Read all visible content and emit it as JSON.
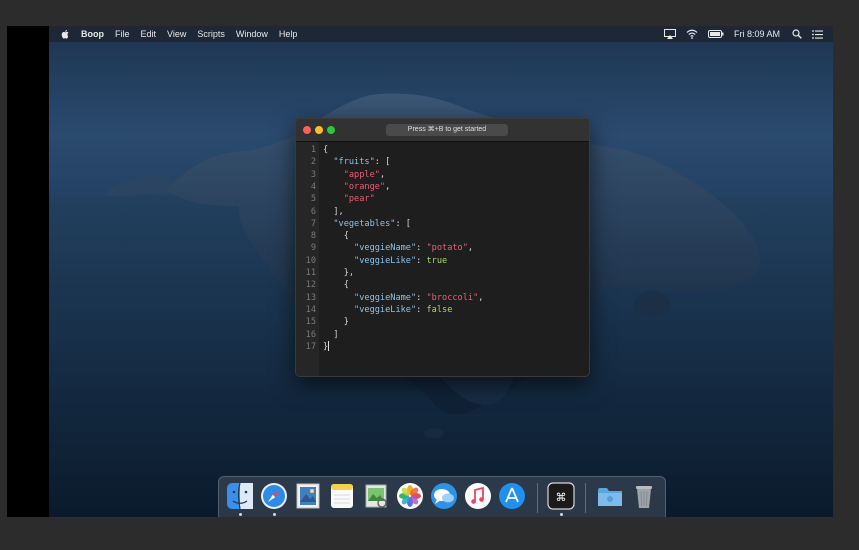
{
  "menubar": {
    "app_name": "Boop",
    "menus": [
      "File",
      "Edit",
      "View",
      "Scripts",
      "Window",
      "Help"
    ],
    "clock": "Fri 8:09 AM"
  },
  "window": {
    "search_placeholder": "Press ⌘+B to get started"
  },
  "editor": {
    "lines": [
      {
        "n": "1",
        "tokens": [
          {
            "t": "{",
            "c": "punc"
          }
        ]
      },
      {
        "n": "2",
        "tokens": [
          {
            "t": "  ",
            "c": "punc"
          },
          {
            "t": "\"fruits\"",
            "c": "key"
          },
          {
            "t": ": [",
            "c": "punc"
          }
        ]
      },
      {
        "n": "3",
        "tokens": [
          {
            "t": "    ",
            "c": "punc"
          },
          {
            "t": "\"apple\"",
            "c": "str"
          },
          {
            "t": ",",
            "c": "punc"
          }
        ]
      },
      {
        "n": "4",
        "tokens": [
          {
            "t": "    ",
            "c": "punc"
          },
          {
            "t": "\"orange\"",
            "c": "str"
          },
          {
            "t": ",",
            "c": "punc"
          }
        ]
      },
      {
        "n": "5",
        "tokens": [
          {
            "t": "    ",
            "c": "punc"
          },
          {
            "t": "\"pear\"",
            "c": "str"
          }
        ]
      },
      {
        "n": "6",
        "tokens": [
          {
            "t": "  ],",
            "c": "punc"
          }
        ]
      },
      {
        "n": "7",
        "tokens": [
          {
            "t": "  ",
            "c": "punc"
          },
          {
            "t": "\"vegetables\"",
            "c": "key"
          },
          {
            "t": ": [",
            "c": "punc"
          }
        ]
      },
      {
        "n": "8",
        "tokens": [
          {
            "t": "    {",
            "c": "punc"
          }
        ]
      },
      {
        "n": "9",
        "tokens": [
          {
            "t": "      ",
            "c": "punc"
          },
          {
            "t": "\"veggieName\"",
            "c": "key"
          },
          {
            "t": ": ",
            "c": "punc"
          },
          {
            "t": "\"potato\"",
            "c": "str"
          },
          {
            "t": ",",
            "c": "punc"
          }
        ]
      },
      {
        "n": "10",
        "tokens": [
          {
            "t": "      ",
            "c": "punc"
          },
          {
            "t": "\"veggieLike\"",
            "c": "key"
          },
          {
            "t": ": ",
            "c": "punc"
          },
          {
            "t": "true",
            "c": "bool"
          }
        ]
      },
      {
        "n": "11",
        "tokens": [
          {
            "t": "    },",
            "c": "punc"
          }
        ]
      },
      {
        "n": "12",
        "tokens": [
          {
            "t": "    {",
            "c": "punc"
          }
        ]
      },
      {
        "n": "13",
        "tokens": [
          {
            "t": "      ",
            "c": "punc"
          },
          {
            "t": "\"veggieName\"",
            "c": "key"
          },
          {
            "t": ": ",
            "c": "punc"
          },
          {
            "t": "\"broccoli\"",
            "c": "str"
          },
          {
            "t": ",",
            "c": "punc"
          }
        ]
      },
      {
        "n": "14",
        "tokens": [
          {
            "t": "      ",
            "c": "punc"
          },
          {
            "t": "\"veggieLike\"",
            "c": "key"
          },
          {
            "t": ": ",
            "c": "punc"
          },
          {
            "t": "false",
            "c": "bool"
          }
        ]
      },
      {
        "n": "15",
        "tokens": [
          {
            "t": "    }",
            "c": "punc"
          }
        ]
      },
      {
        "n": "16",
        "tokens": [
          {
            "t": "  ]",
            "c": "punc"
          }
        ]
      },
      {
        "n": "17",
        "tokens": [
          {
            "t": "}",
            "c": "punc"
          }
        ]
      }
    ]
  },
  "dock": {
    "items": [
      {
        "name": "finder-icon",
        "running": true
      },
      {
        "name": "safari-icon",
        "running": true
      },
      {
        "name": "mail-icon",
        "running": false
      },
      {
        "name": "notes-icon",
        "running": false
      },
      {
        "name": "maps-icon",
        "running": false
      },
      {
        "name": "photos-icon",
        "running": false
      },
      {
        "name": "messages-icon",
        "running": false
      },
      {
        "name": "music-icon",
        "running": false
      },
      {
        "name": "app-store-icon",
        "running": false
      },
      {
        "name": "boop-icon",
        "running": true
      },
      {
        "name": "folder-icon",
        "running": false
      },
      {
        "name": "trash-icon",
        "running": false
      }
    ]
  },
  "colors": {
    "key": "#8cc3ec",
    "string": "#ee5d77",
    "boolean": "#a6d95d"
  }
}
